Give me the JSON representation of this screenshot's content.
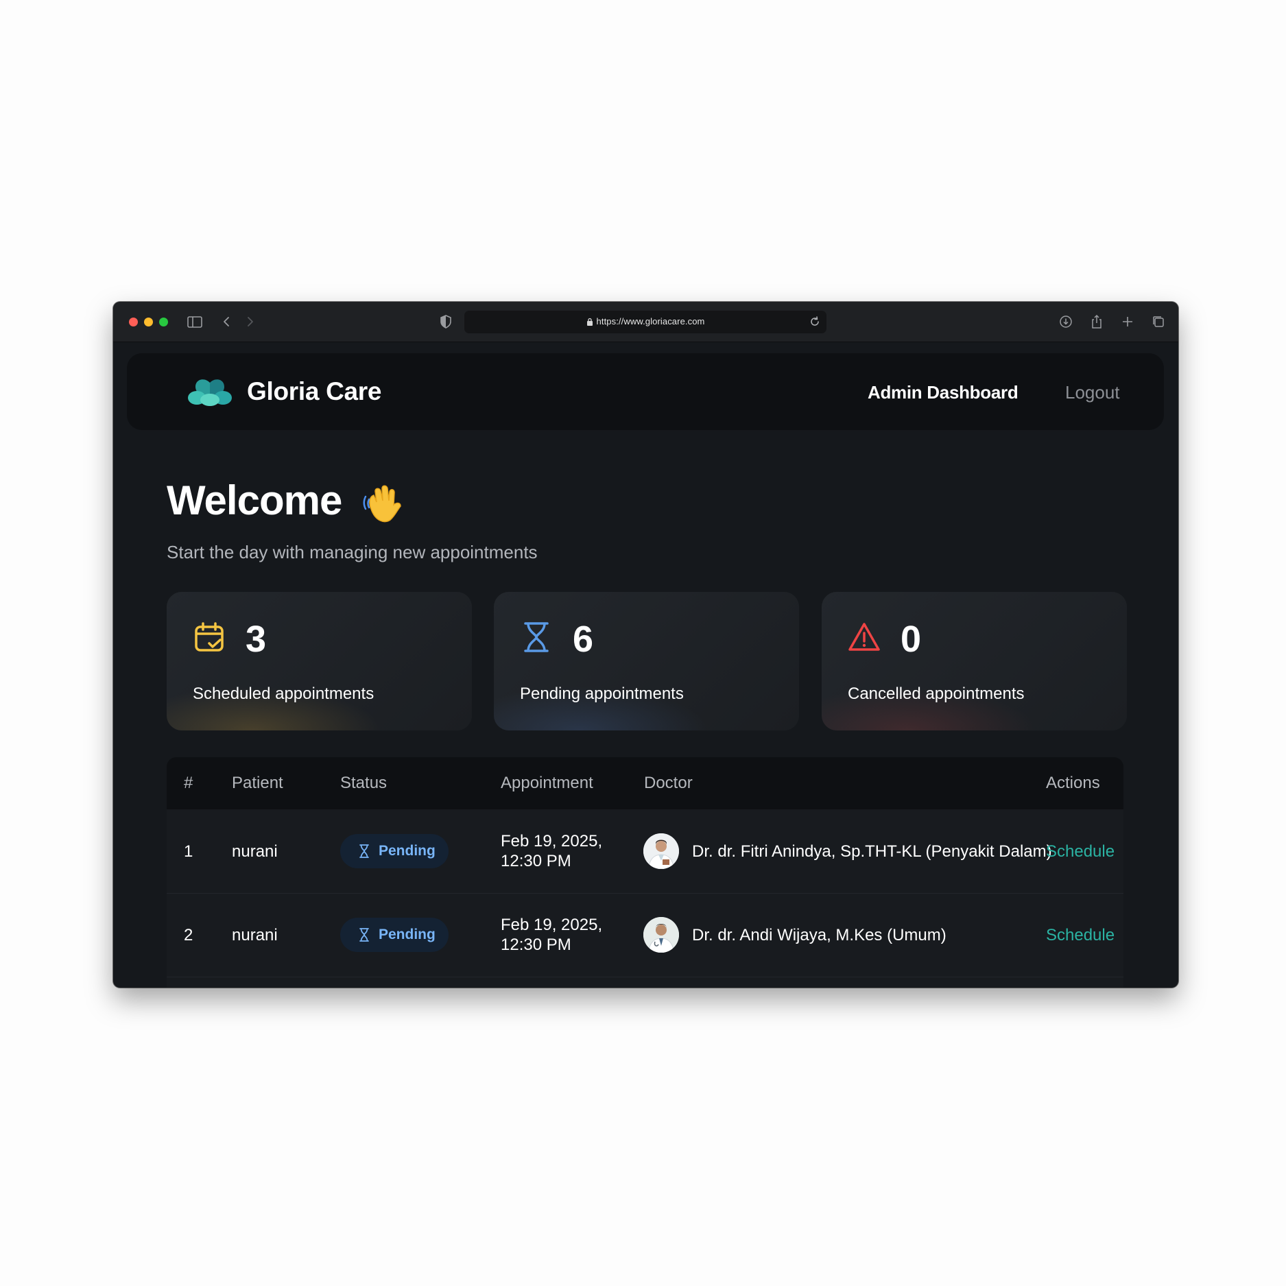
{
  "browser": {
    "url": "https://www.gloriacare.com"
  },
  "nav": {
    "brand": "Gloria Care",
    "admin_link": "Admin Dashboard",
    "logout_link": "Logout"
  },
  "hero": {
    "title": "Welcome",
    "subtitle": "Start the day with managing new appointments"
  },
  "stats": [
    {
      "value": "3",
      "label": "Scheduled appointments",
      "icon": "calendar-check-icon",
      "color": "#f5c542"
    },
    {
      "value": "6",
      "label": "Pending appointments",
      "icon": "hourglass-icon",
      "color": "#5a9ae6"
    },
    {
      "value": "0",
      "label": "Cancelled appointments",
      "icon": "warning-icon",
      "color": "#ef4444"
    }
  ],
  "table": {
    "headers": [
      "#",
      "Patient",
      "Status",
      "Appointment",
      "Doctor",
      "Actions"
    ],
    "rows": [
      {
        "num": "1",
        "patient": "nurani",
        "status": "Pending",
        "date_line1": "Feb 19, 2025,",
        "date_line2": "12:30 PM",
        "doctor": "Dr. dr. Fitri Anindya, Sp.THT-KL (Penyakit Dalam)",
        "action": "Schedule"
      },
      {
        "num": "2",
        "patient": "nurani",
        "status": "Pending",
        "date_line1": "Feb 19, 2025,",
        "date_line2": "12:30 PM",
        "doctor": "Dr. dr. Andi Wijaya, M.Kes (Umum)",
        "action": "Schedule"
      }
    ]
  },
  "colors": {
    "accent": "#2bb3a3",
    "pending_badge_text": "#79b5f7",
    "pending_badge_bg": "#142233"
  }
}
